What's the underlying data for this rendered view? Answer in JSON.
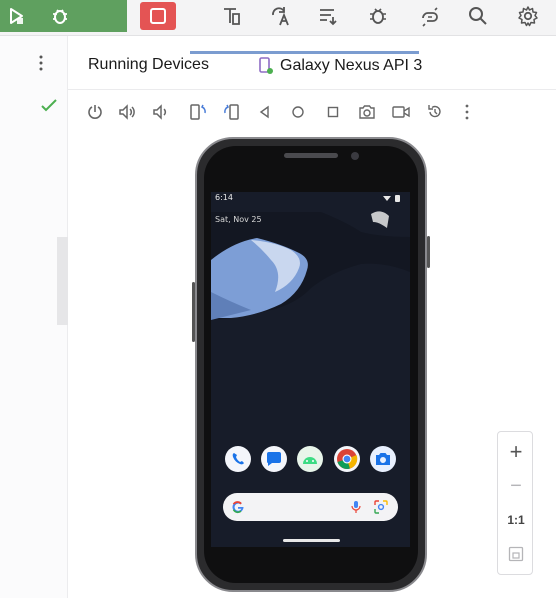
{
  "toolbar": {
    "icons": [
      "run-icon",
      "debug-icon",
      "stop-icon",
      "profile-icon",
      "apply-changes-icon",
      "apply-code-changes-icon",
      "attach-debugger-icon",
      "sync-project-icon",
      "search-icon",
      "settings-icon"
    ]
  },
  "tool_window": {
    "title": "Running Devices",
    "device_tab_label": "Galaxy Nexus API 3"
  },
  "device_controls": [
    "power-icon",
    "volume-up-icon",
    "volume-down-icon",
    "rotate-left-icon",
    "rotate-right-icon",
    "back-icon",
    "home-icon",
    "overview-icon",
    "screenshot-icon",
    "screen-record-icon",
    "reset-icon",
    "more-icon"
  ],
  "phone_screen": {
    "status_time": "6:14",
    "date": "Sat, Nov 25",
    "dock_apps": [
      "phone-app-icon",
      "messages-app-icon",
      "android-app-icon",
      "chrome-app-icon",
      "camera-app-icon"
    ]
  },
  "zoom": {
    "zoom_in": "+",
    "zoom_out": "−",
    "actual_size": "1:1"
  },
  "colors": {
    "run_green": "#5fa05f",
    "stop_red": "#e45454",
    "tab_underline": "#7b9cd0",
    "check_green": "#4caf50"
  }
}
